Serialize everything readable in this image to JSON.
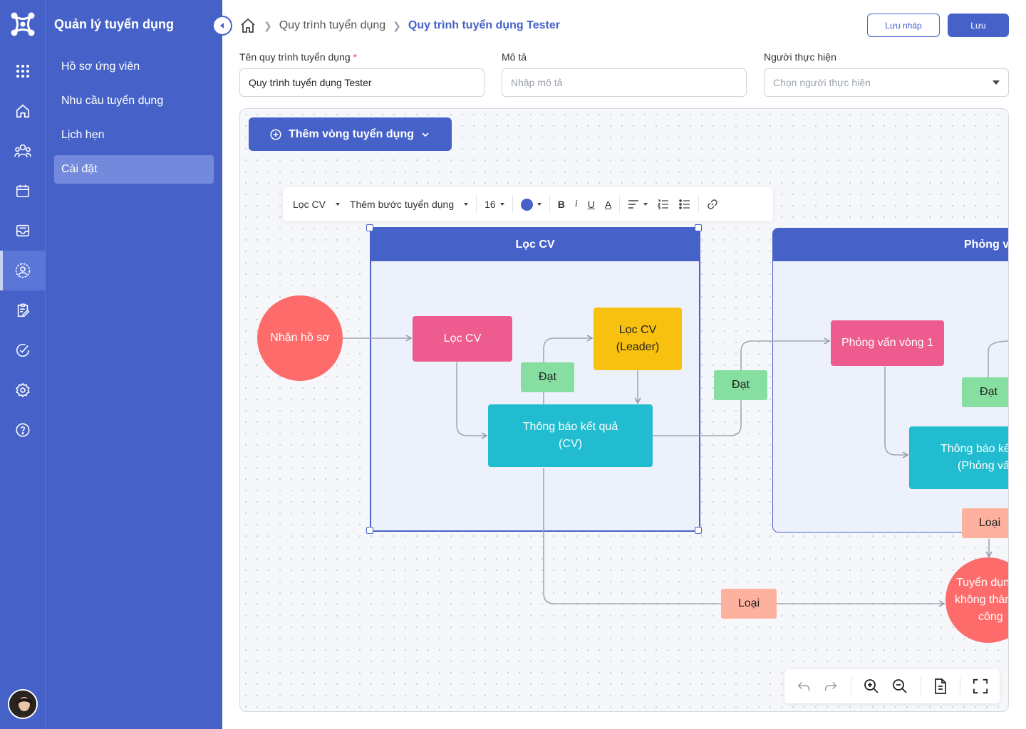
{
  "app": {
    "title": "Quản lý tuyển dụng"
  },
  "rail": {
    "icons": [
      "apps-grid-icon",
      "home-icon",
      "users-icon",
      "calendar-icon",
      "inbox-icon",
      "user-settings-icon",
      "clipboard-edit-icon",
      "check-circle-icon",
      "gear-icon",
      "help-circle-icon"
    ],
    "active": "user-settings-icon"
  },
  "sidebar": {
    "items": [
      {
        "label": "Hồ sơ ứng viên"
      },
      {
        "label": "Nhu cầu tuyển dụng"
      },
      {
        "label": "Lịch hẹn"
      },
      {
        "label": "Cài đặt",
        "active": true
      }
    ]
  },
  "breadcrumb": {
    "parent": "Quy trình tuyển dụng",
    "current": "Quy trình tuyển dụng Tester"
  },
  "actions": {
    "draft": "Lưu nháp",
    "save": "Lưu"
  },
  "form": {
    "name_label": "Tên quy trình tuyển dụng",
    "required_mark": "*",
    "name_value": "Quy trình tuyển dụng Tester",
    "desc_label": "Mô tả",
    "desc_placeholder": "Nhập mô tả",
    "assignee_label": "Người thực hiện",
    "assignee_placeholder": "Chọn người thực hiện"
  },
  "canvas": {
    "add_round": "Thêm vòng tuyển dụng",
    "toolbar": {
      "round": "Lọc CV",
      "add_step": "Thêm bước tuyển dụng",
      "font_size": "16",
      "color": "#4662c8"
    },
    "groups": {
      "g1": "Lọc CV",
      "g2": "Phỏng vấn"
    },
    "nodes": {
      "receive": "Nhận hồ sơ",
      "filter_cv": "Lọc CV",
      "filter_leader_1": "Lọc CV",
      "filter_leader_2": "(Leader)",
      "notify_cv_1": "Thông báo kết quả",
      "notify_cv_2": "(CV)",
      "interview1": "Phỏng vấn vòng 1",
      "notify_iv_1": "Thông báo kết quả",
      "notify_iv_2": "(Phỏng vấn)",
      "fail_1": "Tuyển dụng",
      "fail_2": "không thành",
      "fail_3": "công"
    },
    "labels": {
      "pass": "Đạt",
      "reject": "Loại"
    },
    "colors": {
      "pink": "#ee5b8f",
      "yellow": "#f8c00f",
      "teal": "#21bccf",
      "coral": "#fd6c6b",
      "green": "#86dfa1",
      "salmon": "#fdb19e"
    }
  }
}
